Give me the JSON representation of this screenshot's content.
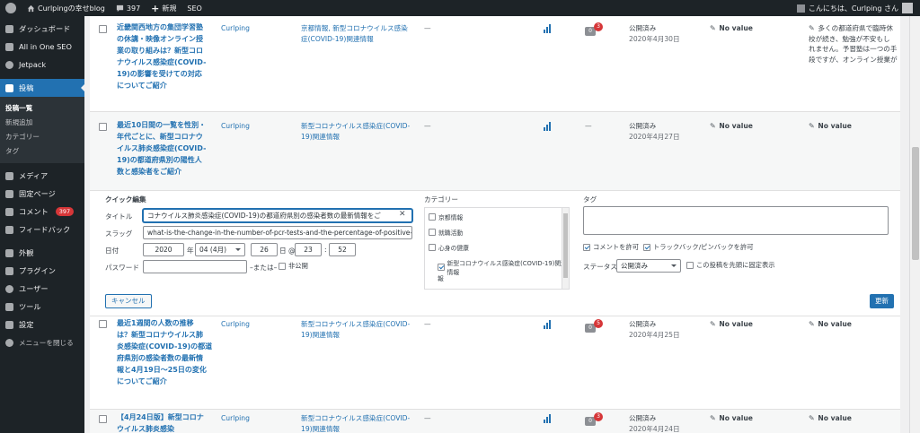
{
  "adminbar": {
    "site_name": "Curlpingの幸せblog",
    "comments_count": "397",
    "new_label": "新規",
    "seo_label": "SEO",
    "greeting": "こんにちは、Curlping さん"
  },
  "sidebar": {
    "items": [
      {
        "label": "ダッシュボード"
      },
      {
        "label": "All in One SEO"
      },
      {
        "label": "Jetpack"
      },
      {
        "label": "投稿"
      },
      {
        "label": "メディア"
      },
      {
        "label": "固定ページ"
      },
      {
        "label": "コメント",
        "badge": "397"
      },
      {
        "label": "フィードバック"
      },
      {
        "label": "外観"
      },
      {
        "label": "プラグイン"
      },
      {
        "label": "ユーザー"
      },
      {
        "label": "ツール"
      },
      {
        "label": "設定"
      },
      {
        "label": "メニューを閉じる"
      }
    ],
    "submenu": [
      "投稿一覧",
      "新規追加",
      "カテゴリー",
      "タグ"
    ]
  },
  "posts": [
    {
      "title_lines": [
        "近畿関西地方の集団学習塾",
        "の休講・映像オンライン授",
        "業の取り組みは？新型コロ",
        "ナウイルス感染症(COVID-",
        "19)の影響を受けての対応",
        "についてご紹介"
      ],
      "author": "Curlping",
      "category_lines": [
        "京都情報, 新型コロナウイルス感染",
        "症(COVID-19)関連情報"
      ],
      "tags": "—",
      "comments": "0",
      "comment_pending": "3",
      "status": "公開済み",
      "date": "2020年4月30日",
      "col1": "No value",
      "col2_lines": [
        "多くの都道府県で臨時休",
        "校が続き、勉強が不安もし",
        "れません。予習塾は一つの手",
        "段ですが、オンライン授業が"
      ]
    },
    {
      "title_lines": [
        "最近10日間の一覧を性別・",
        "年代ごとに、新型コロナウ",
        "イルス肺炎感染症(COVID-",
        "19)の都道府県別の陽性人",
        "数と感染者をご紹介"
      ],
      "author": "Curlping",
      "category_lines": [
        "新型コロナウイルス感染症(COVID-",
        "19)関連情報"
      ],
      "tags": "—",
      "comments": "—",
      "status": "公開済み",
      "date": "2020年4月27日",
      "col1": "No value",
      "col2": "No value"
    },
    {
      "title_lines": [
        "最近1週間の人数の推移",
        "は？新型コロナウイルス肺",
        "炎感染症(COVID-19)の都道",
        "府県別の感染者数の最新情",
        "報と4月19日〜25日の変化",
        "についてご紹介"
      ],
      "author": "Curlping",
      "category_lines": [
        "新型コロナウイルス感染症(COVID-",
        "19)関連情報"
      ],
      "tags": "—",
      "comments": "0",
      "comment_pending": "5",
      "status": "公開済み",
      "date": "2020年4月25日",
      "col1": "No value",
      "col2": "No value"
    },
    {
      "title_lines": [
        "【4月24日版】新型コロナ",
        "ウイルス肺炎感染"
      ],
      "author": "Curlping",
      "category_lines": [
        "新型コロナウイルス感染症(COVID-",
        "19)関連情報"
      ],
      "tags": "—",
      "comments": "0",
      "comment_pending": "3",
      "status": "公開済み",
      "date": "2020年4月24日",
      "col1": "No value",
      "col2": "No value"
    }
  ],
  "quick_edit": {
    "heading": "クイック編集",
    "title_label": "タイトル",
    "title_value": "コナウイルス肺炎感染症(COVID-19)の都道府県別の感染者数の最新情報をご",
    "slug_label": "スラッグ",
    "slug_value": "what-is-the-change-in-the-number-of-pcr-tests-and-the-percentage-of-positive-s",
    "date_label": "日付",
    "year": "2020",
    "year_suffix": "年",
    "month": "04 (4月)",
    "day": "26",
    "day_suffix": "日 @",
    "hour": "23",
    "colon": ":",
    "minute": "52",
    "password_label": "パスワード",
    "or_label": "–または–",
    "private_label": "非公開",
    "category_heading": "カテゴリー",
    "categories": [
      {
        "label": "京都情報",
        "checked": false
      },
      {
        "label": "就職活動",
        "checked": false
      },
      {
        "label": "心身の健康",
        "checked": false
      },
      {
        "label": "新型コロナウイルス感染症(COVID-19)関連情報",
        "checked": true
      },
      {
        "label": "報",
        "checked": false
      }
    ],
    "tag_heading": "タグ",
    "allow_comments": "コメントを許可",
    "allow_pings": "トラックバック/ピンバックを許可",
    "status_label": "ステータス",
    "status_value": "公開済み",
    "sticky_label": "この投稿を先頭に固定表示",
    "cancel_button": "キャンセル",
    "update_button": "更新"
  }
}
